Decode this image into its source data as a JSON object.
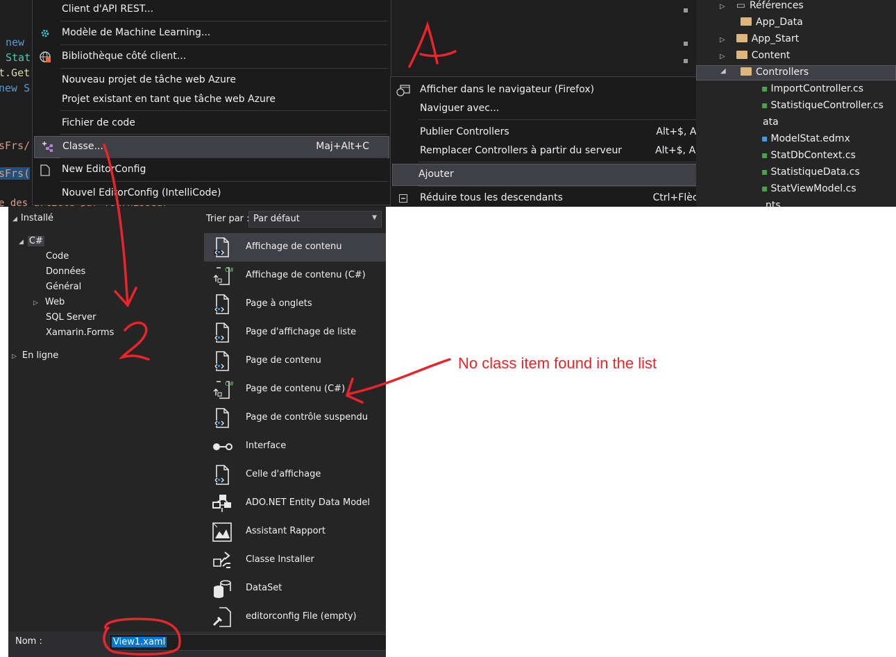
{
  "code_fragments": [
    "new",
    "Stat",
    "t.Get",
    "new S",
    "sFrs/",
    "sFrs(",
    "e des article par fournisseur"
  ],
  "left_menu": {
    "items": [
      {
        "label": "Client d'API REST...",
        "icon": "rest-icon"
      },
      {
        "label": "Modèle de Machine Learning...",
        "icon": "ml-gear-icon"
      },
      {
        "label": "Bibliothèque côté client...",
        "icon": "globe-icon"
      },
      {
        "label": "Nouveau projet de tâche web Azure",
        "icon": ""
      },
      {
        "label": "Projet existant en tant que tâche web Azure",
        "icon": ""
      },
      {
        "label": "Fichier de code",
        "icon": ""
      },
      {
        "label": "Classe...",
        "shortcut": "Maj+Alt+C",
        "icon": "class-icon"
      },
      {
        "label": "New EditorConfig",
        "icon": "file-icon"
      },
      {
        "label": "Nouvel EditorConfig (IntelliCode)",
        "icon": ""
      }
    ]
  },
  "context_menu": {
    "items": [
      {
        "label": "Afficher dans le navigateur (Firefox)",
        "shortcut": "",
        "icon": "browser-icon"
      },
      {
        "label": "Naviguer avec...",
        "shortcut": ""
      },
      {
        "label": "Publier Controllers",
        "shortcut": "Alt+$, Alt+P"
      },
      {
        "label": "Remplacer Controllers à partir du serveur",
        "shortcut": "Alt+$, Alt+R"
      },
      {
        "label": "Ajouter",
        "shortcut": ""
      },
      {
        "label": "Réduire tous les descendants",
        "shortcut": "Ctrl+Flèche gauche",
        "icon": "collapse-icon"
      }
    ]
  },
  "solution_explorer": {
    "rows": [
      "Références",
      "App_Data",
      "App_Start",
      "Content",
      "Controllers",
      "ImportController.cs",
      "StatistiqueController.cs",
      "ata",
      "ModelStat.edmx",
      "StatDbContext.cs",
      "StatistiqueData.cs",
      "StatViewModel.cs",
      "nts"
    ]
  },
  "dialog": {
    "installed_label": "Installé",
    "sort_label": "Trier par :",
    "sort_value": "Par défaut",
    "tree": {
      "root": "C#",
      "children": [
        "Code",
        "Données",
        "Général",
        "Web",
        "SQL Server",
        "Xamarin.Forms"
      ],
      "online": "En ligne"
    },
    "templates": [
      {
        "label": "Affichage de contenu",
        "icon": "xaml-file-icon"
      },
      {
        "label": "Affichage de contenu (C#)",
        "icon": "csharp-view-icon"
      },
      {
        "label": "Page à onglets",
        "icon": "xaml-file-icon"
      },
      {
        "label": "Page d'affichage de liste",
        "icon": "xaml-file-icon"
      },
      {
        "label": "Page de contenu",
        "icon": "xaml-file-icon"
      },
      {
        "label": "Page de contenu (C#)",
        "icon": "csharp-view-icon"
      },
      {
        "label": "Page de contrôle suspendu",
        "icon": "xaml-file-icon"
      },
      {
        "label": "Interface",
        "icon": "interface-icon"
      },
      {
        "label": "Celle d'affichage",
        "icon": "xaml-file-icon"
      },
      {
        "label": "ADO.NET Entity Data Model",
        "icon": "entity-model-icon"
      },
      {
        "label": "Assistant Rapport",
        "icon": "report-icon"
      },
      {
        "label": "Classe Installer",
        "icon": "installer-icon"
      },
      {
        "label": "DataSet",
        "icon": "dataset-icon"
      },
      {
        "label": "editorconfig File (empty)",
        "icon": "editorconfig-icon"
      }
    ],
    "name_label": "Nom :",
    "name_value": "View1.xaml"
  },
  "annotations": {
    "note": "No class item found in the list",
    "mark_1": "1",
    "mark_2": "2",
    "color": "#e8252b"
  }
}
